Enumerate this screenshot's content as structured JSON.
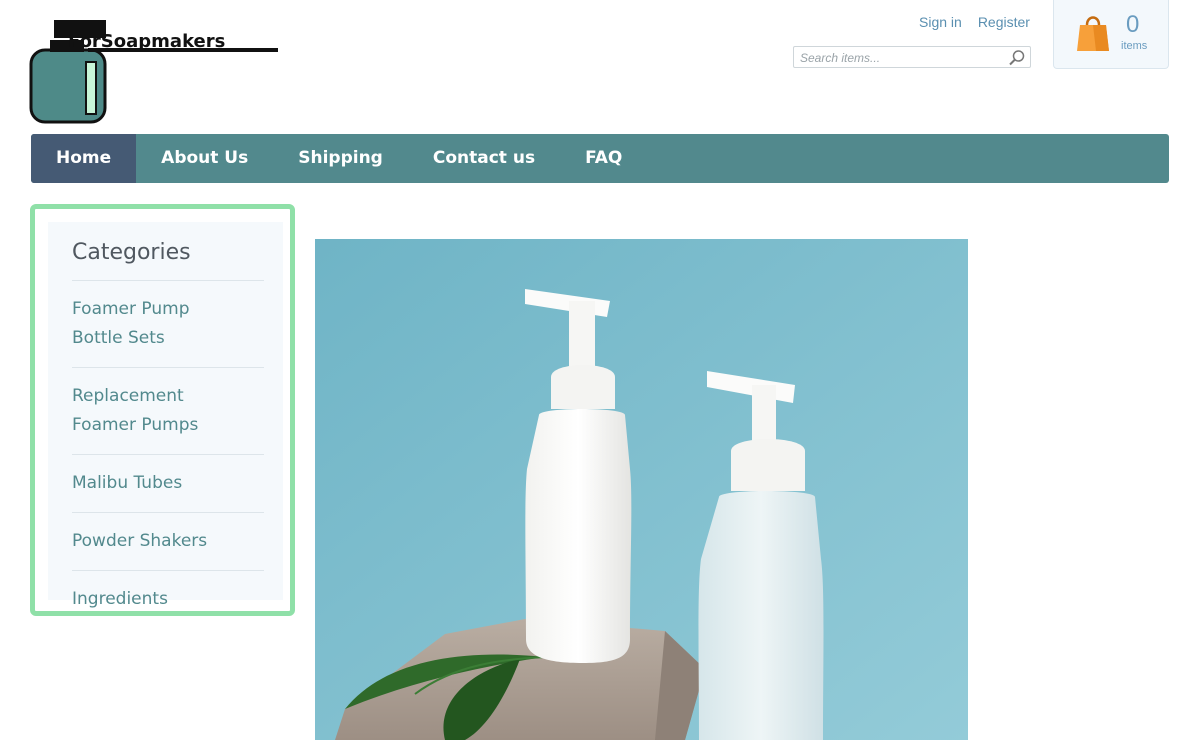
{
  "brand": {
    "name": "ForSoapmakers"
  },
  "header": {
    "sign_in": "Sign in",
    "register": "Register",
    "search_placeholder": "Search items...",
    "cart": {
      "count": "0",
      "label": "items"
    }
  },
  "nav": {
    "items": [
      {
        "label": "Home",
        "active": true
      },
      {
        "label": "About Us"
      },
      {
        "label": "Shipping"
      },
      {
        "label": "Contact us"
      },
      {
        "label": "FAQ"
      }
    ]
  },
  "sidebar": {
    "title": "Categories",
    "items": [
      {
        "label_line1": "Foamer Pump",
        "label_line2": "Bottle Sets"
      },
      {
        "label_line1": "Replacement",
        "label_line2": "Foamer Pumps"
      },
      {
        "label_line1": "Malibu Tubes"
      },
      {
        "label_line1": "Powder Shakers"
      },
      {
        "label_line1": "Ingredients"
      }
    ]
  },
  "colors": {
    "nav_bg": "#52898d",
    "nav_active": "#455a74",
    "link": "#5a8fb0",
    "sidebar_border": "#8fe0a8",
    "hero_bg": "#7fbfcf"
  },
  "icons": [
    "search-icon",
    "shopping-bag-icon"
  ]
}
